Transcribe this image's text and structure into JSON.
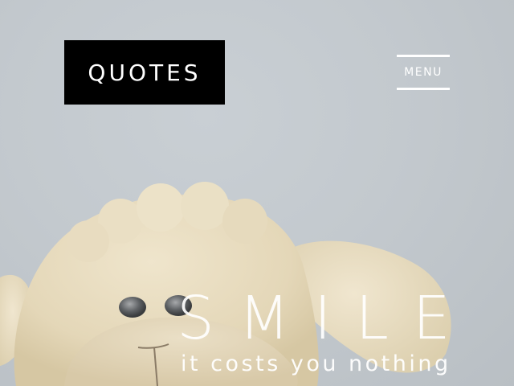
{
  "header": {
    "logo_text": "QUOTES",
    "menu_label": "MENU"
  },
  "hero": {
    "headline": "SMILE",
    "subline": "it costs you nothing",
    "image_subject": "plush-sheep-toy"
  },
  "colors": {
    "background": "#c3c9ce",
    "logo_bg": "#000000",
    "text": "#ffffff",
    "plush": "#e8dcc0"
  }
}
